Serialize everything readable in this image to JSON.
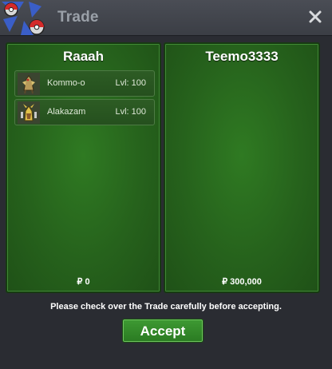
{
  "window": {
    "title": "Trade"
  },
  "left_panel": {
    "player_name": "Raaah",
    "items": [
      {
        "name": "Kommo-o",
        "level": "Lvl: 100",
        "icon": "kommo-o-sprite-icon"
      },
      {
        "name": "Alakazam",
        "level": "Lvl: 100",
        "icon": "alakazam-sprite-icon"
      }
    ],
    "money": "₽ 0"
  },
  "right_panel": {
    "player_name": "Teemo3333",
    "items": [],
    "money": "₽ 300,000"
  },
  "notice": "Please check over the Trade carefully before accepting.",
  "accept_label": "Accept",
  "colors": {
    "panel_green": "#2f7a22",
    "button_green": "#3e9a33",
    "titlebar": "#4a4d55"
  }
}
